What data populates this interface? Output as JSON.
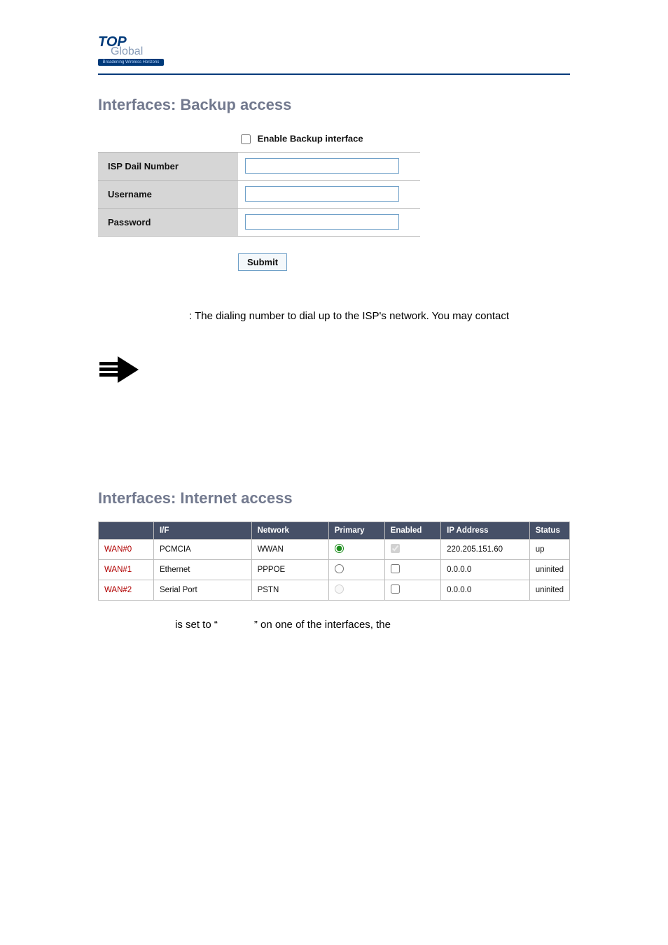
{
  "logo": {
    "top": "TOP",
    "global": "Global",
    "tagline": "Broadening Wireless Horizons"
  },
  "backup": {
    "heading": "Interfaces: Backup access",
    "enable_label": "Enable Backup interface",
    "rows": {
      "isp_label": "ISP Dail Number",
      "isp_value": "",
      "user_label": "Username",
      "user_value": "",
      "pass_label": "Password",
      "pass_value": ""
    },
    "submit": "Submit"
  },
  "desc_line": ": The dialing number to dial up to the ISP's network. You may contact",
  "internet": {
    "heading": "Interfaces: Internet access",
    "cols": {
      "blank": "",
      "if": "I/F",
      "network": "Network",
      "primary": "Primary",
      "enabled": "Enabled",
      "ip": "IP Address",
      "status": "Status"
    },
    "rows": [
      {
        "name": "WAN#0",
        "if": "PCMCIA",
        "network": "WWAN",
        "primary": true,
        "enabled": true,
        "enabled_disabled": true,
        "primary_disabled": false,
        "ip": "220.205.151.60",
        "status": "up"
      },
      {
        "name": "WAN#1",
        "if": "Ethernet",
        "network": "PPPOE",
        "primary": false,
        "enabled": false,
        "enabled_disabled": false,
        "primary_disabled": false,
        "ip": "0.0.0.0",
        "status": "uninited"
      },
      {
        "name": "WAN#2",
        "if": "Serial Port",
        "network": "PSTN",
        "primary": false,
        "enabled": false,
        "enabled_disabled": false,
        "primary_disabled": true,
        "ip": "0.0.0.0",
        "status": "uninited"
      }
    ]
  },
  "caption": {
    "pre": "is set to “",
    "mid": "” on one of the interfaces, the"
  }
}
